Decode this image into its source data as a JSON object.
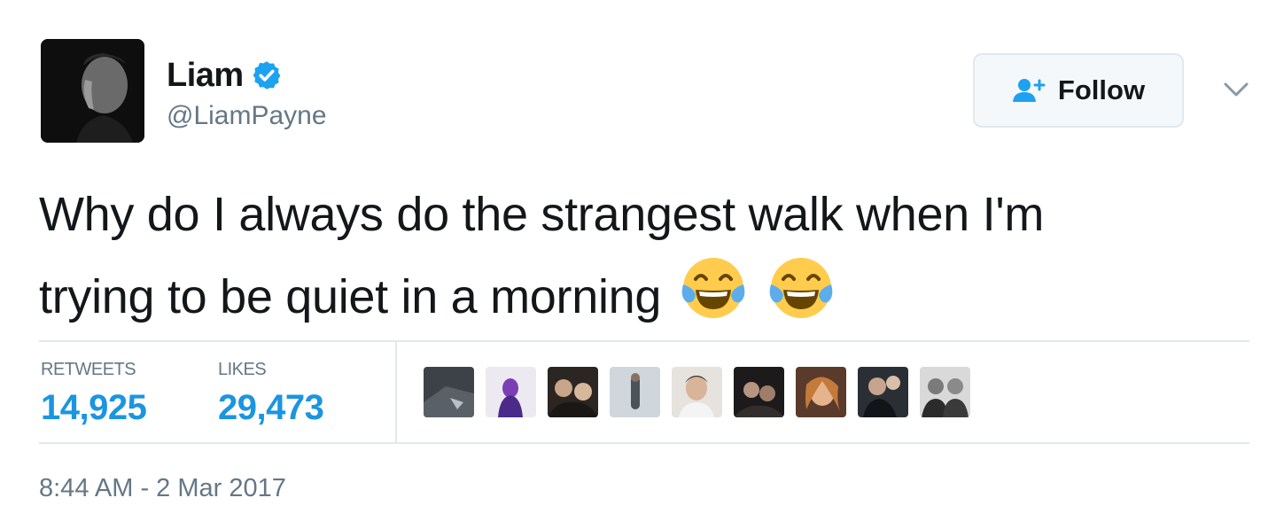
{
  "user": {
    "display_name": "Liam",
    "handle": "@LiamPayne",
    "verified": true,
    "avatar_icon": "profile-photo"
  },
  "follow_button": {
    "label": "Follow",
    "icon": "add-user-icon"
  },
  "menu_caret_icon": "chevron-down-icon",
  "tweet": {
    "text_line1": "Why do I always do the strangest walk when I'm",
    "text_line2": "trying to be quiet in a morning",
    "emojis": [
      "face-with-tears-of-joy",
      "face-with-tears-of-joy"
    ]
  },
  "stats": {
    "retweets_label": "RETWEETS",
    "retweets_value": "14,925",
    "likes_label": "LIKES",
    "likes_value": "29,473"
  },
  "likers": [
    {
      "name": "liker-avatar-1"
    },
    {
      "name": "liker-avatar-2"
    },
    {
      "name": "liker-avatar-3"
    },
    {
      "name": "liker-avatar-4"
    },
    {
      "name": "liker-avatar-5"
    },
    {
      "name": "liker-avatar-6"
    },
    {
      "name": "liker-avatar-7"
    },
    {
      "name": "liker-avatar-8"
    },
    {
      "name": "liker-avatar-9"
    }
  ],
  "timestamp": "8:44 AM - 2 Mar 2017",
  "colors": {
    "accent": "#1b95e0",
    "verified": "#1da1f2",
    "muted": "#657786",
    "text": "#14171a",
    "border": "#e1e8ed"
  }
}
